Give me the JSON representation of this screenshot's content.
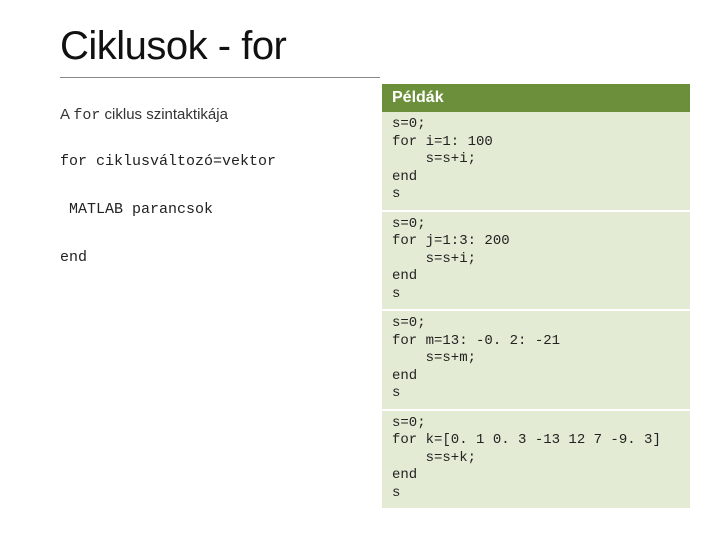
{
  "title": "Ciklusok - for",
  "left": {
    "caption_prefix": "A ",
    "caption_mono": "for",
    "caption_suffix": " ciklus szintaktikája",
    "syntax": "for ciklusváltozó=vektor\n\n MATLAB parancsok\n\nend"
  },
  "right": {
    "header": "Példák",
    "examples": [
      "s=0;\nfor i=1: 100\n    s=s+i;\nend\ns",
      "s=0;\nfor j=1:3: 200\n    s=s+i;\nend\ns",
      "s=0;\nfor m=13: -0. 2: -21\n    s=s+m;\nend\ns",
      "s=0;\nfor k=[0. 1 0. 3 -13 12 7 -9. 3]\n    s=s+k;\nend\ns"
    ]
  }
}
